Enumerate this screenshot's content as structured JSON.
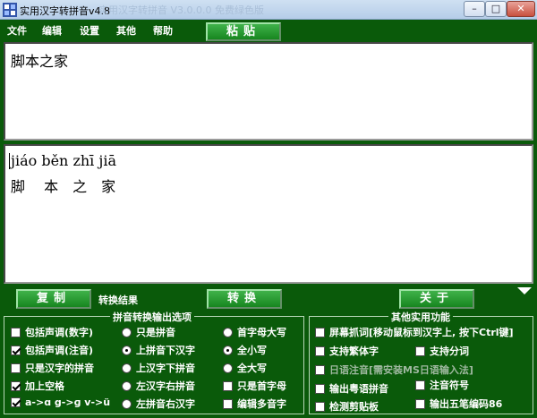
{
  "window": {
    "title": "实用汉字转拼音v4.8",
    "ghost_title": "实用汉字转拼音 V3.0.0.0 免费绿色版",
    "min_glyph": "–",
    "max_glyph": "□",
    "close_glyph": "✕"
  },
  "menu": [
    "文件",
    "编辑",
    "设置",
    "其他",
    "帮助"
  ],
  "buttons": {
    "paste": "粘贴",
    "copy": "复制",
    "convert": "转换",
    "about": "关于"
  },
  "labels": {
    "result": "转换结果"
  },
  "input_text": "脚本之家",
  "output": {
    "pinyin": "jiáo běn zhī jiā",
    "hanzi": "脚　 本　之　家"
  },
  "pinyin_options": {
    "title": "拼音转换输出选项",
    "col1": [
      {
        "label": "包括声调(数字)",
        "checked": false
      },
      {
        "label": "包括声调(注音)",
        "checked": true
      },
      {
        "label": "只是汉字的拼音",
        "checked": false
      },
      {
        "label": "加上空格",
        "checked": true
      },
      {
        "label": "a->ɑ g->ɡ v->ü",
        "checked": true
      }
    ],
    "col2": [
      {
        "label": "只是拼音",
        "selected": false
      },
      {
        "label": "上拼音下汉字",
        "selected": true
      },
      {
        "label": "上汉字下拼音",
        "selected": false
      },
      {
        "label": "左汉字右拼音",
        "selected": false
      },
      {
        "label": "左拼音右汉字",
        "selected": false
      }
    ],
    "col3_radio": [
      {
        "label": "首字母大写",
        "selected": false
      },
      {
        "label": "全小写",
        "selected": true
      },
      {
        "label": "全大写",
        "selected": false
      }
    ],
    "col3_check": [
      {
        "label": "只是首字母",
        "checked": false
      },
      {
        "label": "编辑多音字",
        "checked": false
      }
    ]
  },
  "other_functions": {
    "title": "其他实用功能",
    "screen_capture": "屏幕抓词[移动鼠标到汉字上, 按下Ctrl键]",
    "traditional": "支持繁体字",
    "separator": "支持分词",
    "japanese": "日语注音[需安装MS日语输入法]",
    "cantonese": "输出粤语拼音",
    "zhuyin": "注音符号",
    "clipboard": "检测剪贴板",
    "wubi": "输出五笔编码86"
  },
  "colors": {
    "background": "#0a5a0a",
    "button": "#1f9a2a"
  }
}
